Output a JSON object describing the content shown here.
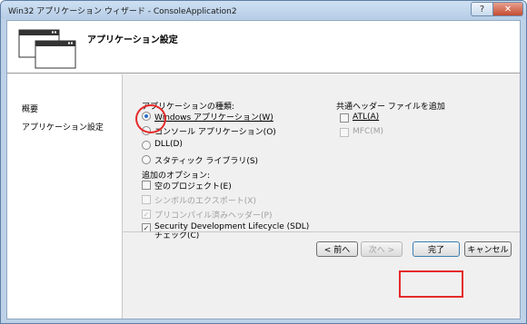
{
  "window": {
    "title": "Win32 アプリケーション ウィザード - ConsoleApplication2",
    "help_glyph": "?",
    "close_glyph": "✕"
  },
  "header": {
    "title": "アプリケーション設定",
    "icon": "wizard-windows-icon"
  },
  "sidebar": {
    "items": [
      {
        "label": "概要"
      },
      {
        "label": "アプリケーション設定"
      }
    ]
  },
  "app_type": {
    "label": "アプリケーションの種類:",
    "options": [
      {
        "label": "Windows アプリケーション(W)",
        "checked": true,
        "enabled": true
      },
      {
        "label": "コンソール アプリケーション(O)",
        "checked": false,
        "enabled": true
      },
      {
        "label": "DLL(D)",
        "checked": false,
        "enabled": true
      },
      {
        "label": "スタティック ライブラリ(S)",
        "checked": false,
        "enabled": true
      }
    ]
  },
  "add_options": {
    "label": "追加のオプション:",
    "options": [
      {
        "label": "空のプロジェクト(E)",
        "checked": false,
        "enabled": true
      },
      {
        "label": "シンボルのエクスポート(X)",
        "checked": false,
        "enabled": false
      },
      {
        "label": "プリコンパイル済みヘッダー(P)",
        "checked": true,
        "enabled": false
      },
      {
        "label": "Security Development Lifecycle (SDL) チェック(C)",
        "checked": true,
        "enabled": true
      }
    ]
  },
  "common_headers": {
    "label": "共通ヘッダー ファイルを追加",
    "options": [
      {
        "label": "ATL(A)",
        "checked": false,
        "enabled": true
      },
      {
        "label": "MFC(M)",
        "checked": false,
        "enabled": false
      }
    ]
  },
  "buttons": {
    "back": "< 前へ",
    "next": "次へ >",
    "finish": "完了",
    "cancel": "キャンセル"
  },
  "colors": {
    "highlight": "#e52b2b",
    "radio_dot": "#2b6fc5",
    "disabled_text": "#a0a0a0"
  }
}
